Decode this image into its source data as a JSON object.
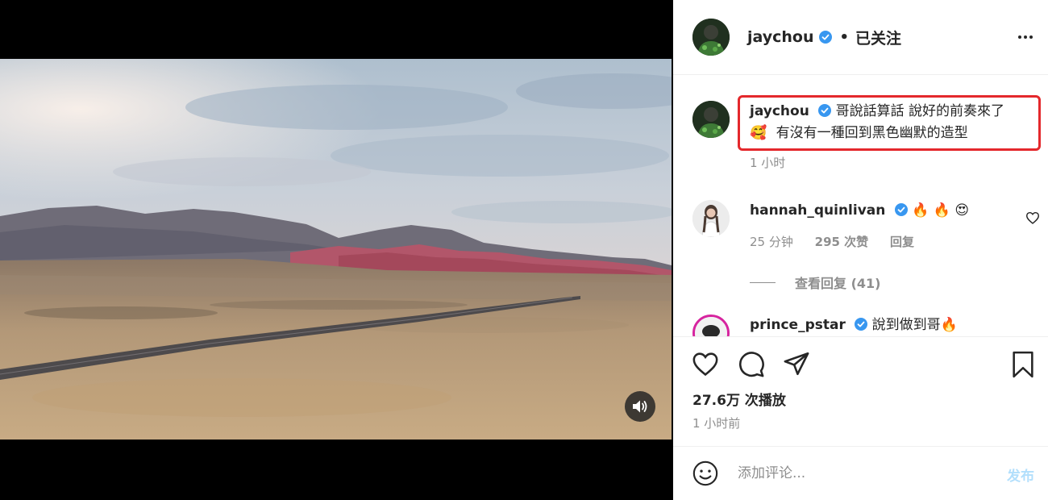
{
  "header": {
    "username": "jaychou",
    "separator": "•",
    "follow_status": "已关注",
    "more_icon": "more-horizontal-icon"
  },
  "caption": {
    "username": "jaychou",
    "text_line1": "哥說話算話 說好的前奏來了",
    "text_line2": "有沒有一種回到黑色幽默的造型",
    "emoji": "🥰",
    "time": "1 小时"
  },
  "comments": [
    {
      "username": "hannah_quinlivan",
      "text": "🔥 🔥 😍",
      "time": "25 分钟",
      "likes": "295 次赞",
      "reply_label": "回复",
      "view_replies": "查看回复 (41)"
    },
    {
      "username": "prince_pstar",
      "text": "說到做到哥🔥"
    }
  ],
  "actions": {
    "views": "27.6万 次播放",
    "time": "1 小时前"
  },
  "add_comment": {
    "placeholder": "添加评论...",
    "post_label": "发布"
  },
  "colors": {
    "verified": "#3897f0",
    "highlight_box": "#e4282c",
    "post_button_disabled": "#b2dffc",
    "muted_text": "#8e8e8e"
  }
}
